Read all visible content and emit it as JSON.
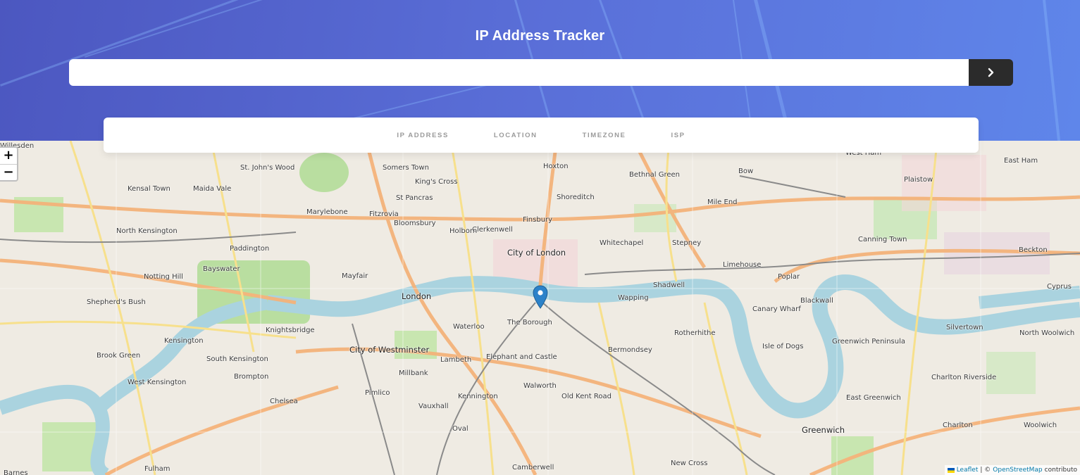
{
  "header": {
    "title": "IP Address Tracker",
    "search": {
      "value": "",
      "placeholder": ""
    },
    "submit_icon": "chevron-right-icon"
  },
  "info": {
    "items": [
      {
        "label": "IP ADDRESS",
        "value": ""
      },
      {
        "label": "LOCATION",
        "value": ""
      },
      {
        "label": "TIMEZONE",
        "value": ""
      },
      {
        "label": "ISP",
        "value": ""
      }
    ]
  },
  "map": {
    "zoom_in": "+",
    "zoom_out": "−",
    "marker_icon": "map-pin-icon",
    "labels": [
      {
        "text": "Willesden"
      },
      {
        "text": "St. John's Wood"
      },
      {
        "text": "Somers Town"
      },
      {
        "text": "Hoxton"
      },
      {
        "text": "Bethnal Green"
      },
      {
        "text": "West Ham"
      },
      {
        "text": "East Ham"
      },
      {
        "text": "Kensal Town"
      },
      {
        "text": "Maida Vale"
      },
      {
        "text": "King's Cross"
      },
      {
        "text": "Shoreditch"
      },
      {
        "text": "Bow"
      },
      {
        "text": "Plaistow"
      },
      {
        "text": "St Pancras"
      },
      {
        "text": "Marylebone"
      },
      {
        "text": "Fitzrovia"
      },
      {
        "text": "Clerkenwell"
      },
      {
        "text": "Mile End"
      },
      {
        "text": "North Kensington"
      },
      {
        "text": "Bloomsbury"
      },
      {
        "text": "Finsbury"
      },
      {
        "text": "Holborn"
      },
      {
        "text": "Paddington"
      },
      {
        "text": "City of London"
      },
      {
        "text": "Whitechapel"
      },
      {
        "text": "Stepney"
      },
      {
        "text": "Canning Town"
      },
      {
        "text": "Beckton"
      },
      {
        "text": "Bayswater"
      },
      {
        "text": "Limehouse"
      },
      {
        "text": "Notting Hill"
      },
      {
        "text": "Mayfair"
      },
      {
        "text": "Poplar"
      },
      {
        "text": "Shadwell"
      },
      {
        "text": "London"
      },
      {
        "text": "Wapping"
      },
      {
        "text": "Blackwall"
      },
      {
        "text": "Shepherd's Bush"
      },
      {
        "text": "Canary Wharf"
      },
      {
        "text": "Waterloo"
      },
      {
        "text": "The Borough"
      },
      {
        "text": "Knightsbridge"
      },
      {
        "text": "Rotherhithe"
      },
      {
        "text": "Silvertown"
      },
      {
        "text": "North Woolwich"
      },
      {
        "text": "Kensington"
      },
      {
        "text": "City of Westminster"
      },
      {
        "text": "Bermondsey"
      },
      {
        "text": "Isle of Dogs"
      },
      {
        "text": "Greenwich Peninsula"
      },
      {
        "text": "Brook Green"
      },
      {
        "text": "South Kensington"
      },
      {
        "text": "Lambeth"
      },
      {
        "text": "Elephant and Castle"
      },
      {
        "text": "Millbank"
      },
      {
        "text": "West Kensington"
      },
      {
        "text": "Brompton"
      },
      {
        "text": "Walworth"
      },
      {
        "text": "Charlton Riverside"
      },
      {
        "text": "Pimlico"
      },
      {
        "text": "Chelsea"
      },
      {
        "text": "Kennington"
      },
      {
        "text": "Old Kent Road"
      },
      {
        "text": "Vauxhall"
      },
      {
        "text": "East Greenwich"
      },
      {
        "text": "Oval"
      },
      {
        "text": "Greenwich"
      },
      {
        "text": "Charlton"
      },
      {
        "text": "Woolwich"
      },
      {
        "text": "Fulham"
      },
      {
        "text": "Camberwell"
      },
      {
        "text": "New Cross"
      },
      {
        "text": "Barnes"
      },
      {
        "text": "Cyprus"
      }
    ]
  },
  "attribution": {
    "leaflet": "Leaflet",
    "separator": " | © ",
    "osm": "OpenStreetMap",
    "suffix": " contributo"
  }
}
